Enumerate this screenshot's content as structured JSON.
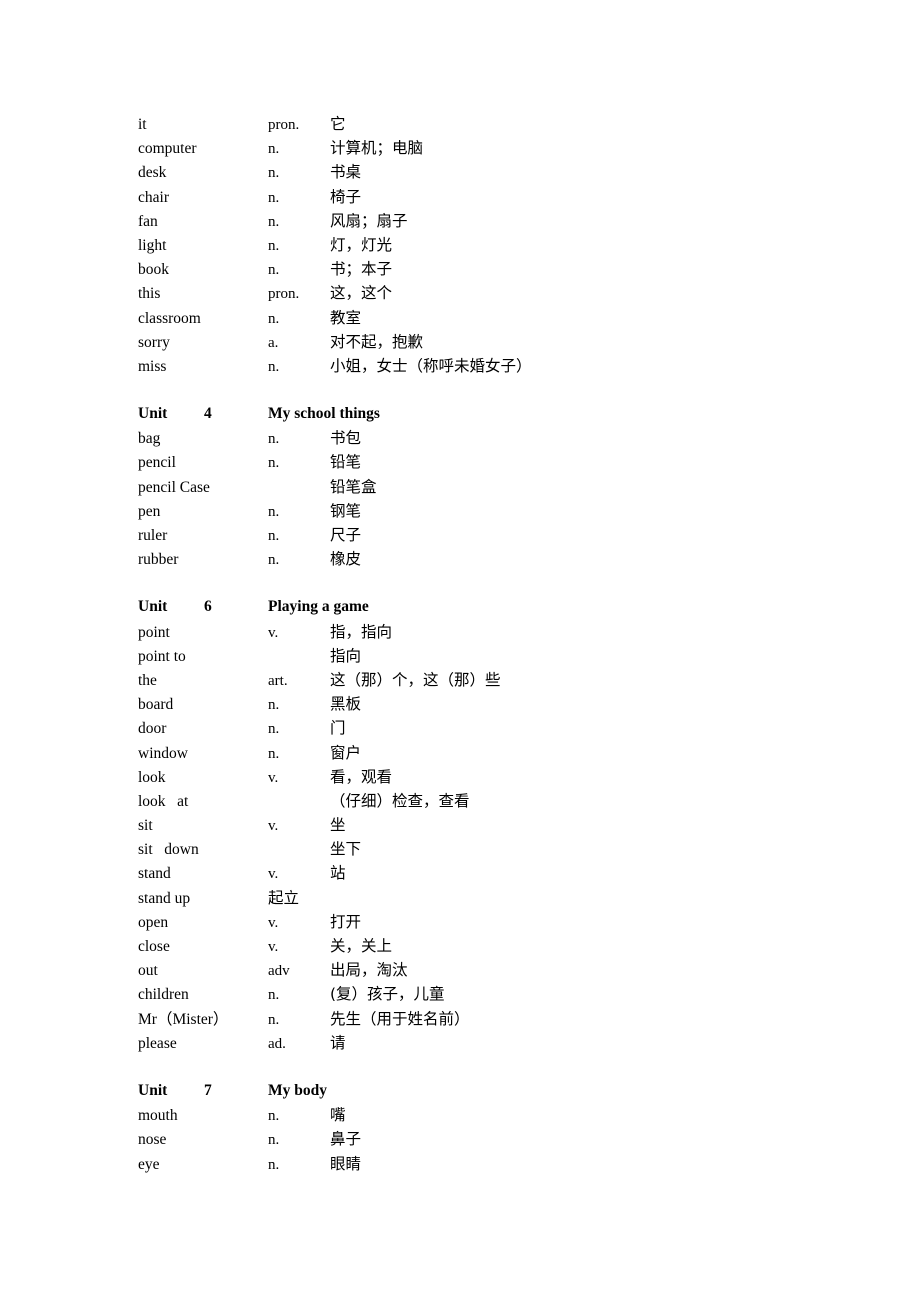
{
  "document": {
    "type": "vocabulary-list",
    "language_pair": "English-Chinese",
    "blocks": [
      {
        "kind": "entries",
        "heading": null,
        "entries": [
          {
            "word": "it",
            "pos": "pron.",
            "definition": "它"
          },
          {
            "word": "computer",
            "pos": "n.",
            "definition": "计算机；电脑"
          },
          {
            "word": "desk",
            "pos": "n.",
            "definition": "书桌"
          },
          {
            "word": "chair",
            "pos": "n.",
            "definition": "椅子"
          },
          {
            "word": "fan",
            "pos": "n.",
            "definition": "风扇；扇子"
          },
          {
            "word": "light",
            "pos": "n.",
            "definition": "灯，灯光"
          },
          {
            "word": "book",
            "pos": "n.",
            "definition": "书；本子"
          },
          {
            "word": "this",
            "pos": "pron.",
            "definition": "这，这个"
          },
          {
            "word": "classroom",
            "pos": "n.",
            "definition": "教室"
          },
          {
            "word": "sorry",
            "pos": "a.",
            "definition": "对不起，抱歉"
          },
          {
            "word": "miss",
            "pos": "n.",
            "definition": "小姐，女士（称呼未婚女子）"
          }
        ]
      },
      {
        "kind": "unit",
        "heading": {
          "label": "Unit",
          "number": "4",
          "title": "My school things"
        },
        "entries": [
          {
            "word": "bag",
            "pos": "n.",
            "definition": "书包"
          },
          {
            "word": "pencil",
            "pos": "n.",
            "definition": "铅笔"
          },
          {
            "word": "pencil Case",
            "pos": "",
            "definition": "铅笔盒"
          },
          {
            "word": "pen",
            "pos": "n.",
            "definition": "钢笔"
          },
          {
            "word": "ruler",
            "pos": "n.",
            "definition": "尺子"
          },
          {
            "word": "rubber",
            "pos": "n.",
            "definition": "橡皮"
          }
        ]
      },
      {
        "kind": "unit",
        "heading": {
          "label": "Unit",
          "number": "6",
          "title": "Playing a game"
        },
        "entries": [
          {
            "word": "point",
            "pos": "v.",
            "definition": "指，指向"
          },
          {
            "word": "point to",
            "pos": "",
            "definition": "指向"
          },
          {
            "word": "the",
            "pos": "art.",
            "definition": "这（那）个，这（那）些"
          },
          {
            "word": "board",
            "pos": "n.",
            "definition": "黑板"
          },
          {
            "word": "door",
            "pos": "n.",
            "definition": "门"
          },
          {
            "word": "window",
            "pos": "n.",
            "definition": "窗户"
          },
          {
            "word": "look",
            "pos": "v.",
            "definition": "看，观看"
          },
          {
            "word": "look   at",
            "pos": "",
            "definition": "（仔细）检查，查看"
          },
          {
            "word": "sit",
            "pos": "v.",
            "definition": "坐"
          },
          {
            "word": "sit   down",
            "pos": "",
            "definition": "坐下"
          },
          {
            "word": "stand",
            "pos": "v.",
            "definition": "站"
          },
          {
            "word": "stand up",
            "pos": "起立",
            "definition": "",
            "def_in_pos": true
          },
          {
            "word": "open",
            "pos": "v.",
            "definition": "打开"
          },
          {
            "word": "close",
            "pos": "v.",
            "definition": "关，关上"
          },
          {
            "word": "out",
            "pos": "adv",
            "definition": "出局，淘汰"
          },
          {
            "word": "children",
            "pos": "n.",
            "definition": "(复）孩子，儿童"
          },
          {
            "word": "Mr（Mister）",
            "pos": "n.",
            "definition": "先生（用于姓名前）"
          },
          {
            "word": "please",
            "pos": "ad.",
            "definition": "请"
          }
        ]
      },
      {
        "kind": "unit",
        "heading": {
          "label": "Unit",
          "number": "7",
          "title": "My body"
        },
        "entries": [
          {
            "word": "mouth",
            "pos": "n.",
            "definition": "嘴"
          },
          {
            "word": "nose",
            "pos": "n.",
            "definition": "鼻子"
          },
          {
            "word": "eye",
            "pos": "n.",
            "definition": "眼睛"
          }
        ]
      }
    ]
  }
}
